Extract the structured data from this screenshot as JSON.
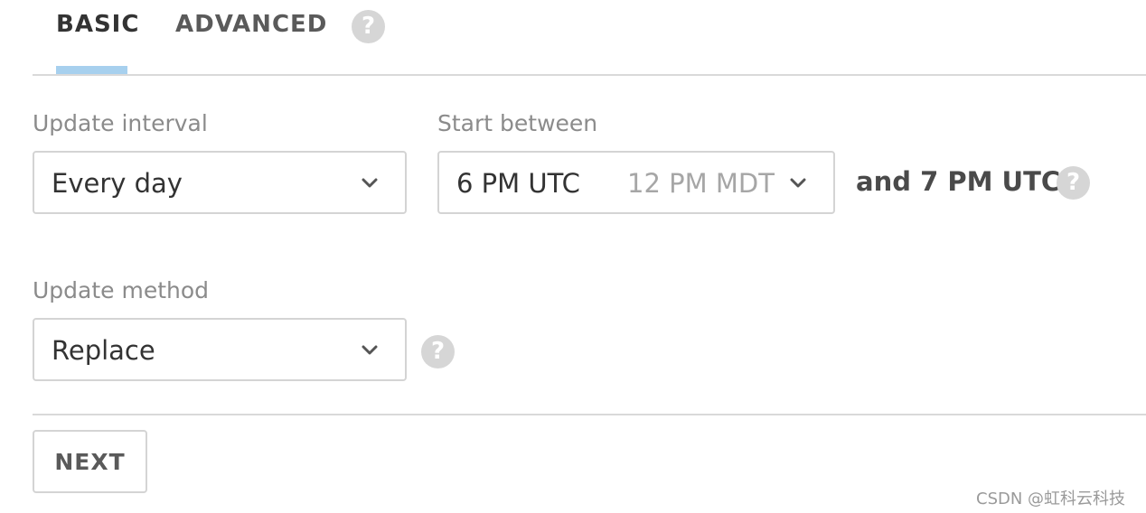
{
  "tabs": {
    "basic": "BASIC",
    "advanced": "ADVANCED",
    "active": "BASIC"
  },
  "update_interval": {
    "label": "Update interval",
    "value": "Every day"
  },
  "start_between": {
    "label": "Start between",
    "value": "6 PM UTC",
    "local_time": "12 PM MDT",
    "end_text": "and 7 PM UTC"
  },
  "update_method": {
    "label": "Update method",
    "value": "Replace"
  },
  "actions": {
    "next_label": "NEXT"
  },
  "icons": {
    "help": "help-circle-icon",
    "dropdown": "chevron-down-icon",
    "help_glyph": "?"
  },
  "colors": {
    "tab_indicator": "#a7d0ee",
    "border": "#d4d4d4",
    "label": "#8b8b8b",
    "help_icon": "#d6d6d6"
  },
  "watermark": "CSDN @虹科云科技"
}
